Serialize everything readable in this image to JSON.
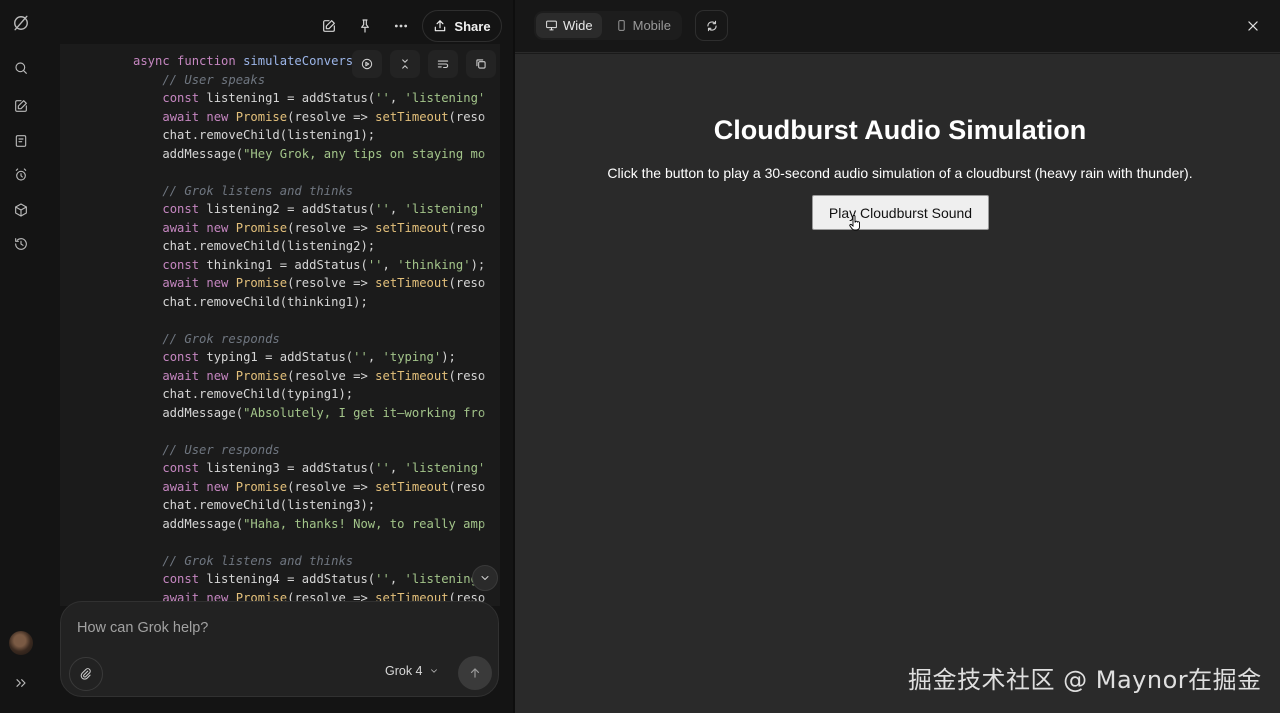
{
  "topbar": {
    "share_label": "Share"
  },
  "code": {
    "lines": [
      [
        {
          "t": "async function ",
          "c": "kw"
        },
        {
          "t": "simulateConvers",
          "c": "fn"
        }
      ],
      [
        {
          "t": "    // User speaks",
          "c": "cm"
        }
      ],
      [
        {
          "t": "    "
        },
        {
          "t": "const",
          "c": "kw"
        },
        {
          "t": " listening1 = addStatus("
        },
        {
          "t": "''",
          "c": "st"
        },
        {
          "t": ", "
        },
        {
          "t": "'listening'",
          "c": "st"
        }
      ],
      [
        {
          "t": "    "
        },
        {
          "t": "await new ",
          "c": "kw"
        },
        {
          "t": "Promise",
          "c": "cl"
        },
        {
          "t": "(resolve => "
        },
        {
          "t": "setTimeout",
          "c": "cl"
        },
        {
          "t": "(reso"
        }
      ],
      [
        {
          "t": "    chat.removeChild(listening1);"
        }
      ],
      [
        {
          "t": "    addMessage("
        },
        {
          "t": "\"Hey Grok, any tips on staying mo",
          "c": "st"
        }
      ],
      [
        {
          "t": ""
        }
      ],
      [
        {
          "t": "    // Grok listens and thinks",
          "c": "cm"
        }
      ],
      [
        {
          "t": "    "
        },
        {
          "t": "const",
          "c": "kw"
        },
        {
          "t": " listening2 = addStatus("
        },
        {
          "t": "''",
          "c": "st"
        },
        {
          "t": ", "
        },
        {
          "t": "'listening'",
          "c": "st"
        }
      ],
      [
        {
          "t": "    "
        },
        {
          "t": "await new ",
          "c": "kw"
        },
        {
          "t": "Promise",
          "c": "cl"
        },
        {
          "t": "(resolve => "
        },
        {
          "t": "setTimeout",
          "c": "cl"
        },
        {
          "t": "(reso"
        }
      ],
      [
        {
          "t": "    chat.removeChild(listening2);"
        }
      ],
      [
        {
          "t": "    "
        },
        {
          "t": "const",
          "c": "kw"
        },
        {
          "t": " thinking1 = addStatus("
        },
        {
          "t": "''",
          "c": "st"
        },
        {
          "t": ", "
        },
        {
          "t": "'thinking'",
          "c": "st"
        },
        {
          "t": ");"
        }
      ],
      [
        {
          "t": "    "
        },
        {
          "t": "await new ",
          "c": "kw"
        },
        {
          "t": "Promise",
          "c": "cl"
        },
        {
          "t": "(resolve => "
        },
        {
          "t": "setTimeout",
          "c": "cl"
        },
        {
          "t": "(reso"
        }
      ],
      [
        {
          "t": "    chat.removeChild(thinking1);"
        }
      ],
      [
        {
          "t": ""
        }
      ],
      [
        {
          "t": "    // Grok responds",
          "c": "cm"
        }
      ],
      [
        {
          "t": "    "
        },
        {
          "t": "const",
          "c": "kw"
        },
        {
          "t": " typing1 = addStatus("
        },
        {
          "t": "''",
          "c": "st"
        },
        {
          "t": ", "
        },
        {
          "t": "'typing'",
          "c": "st"
        },
        {
          "t": ");"
        }
      ],
      [
        {
          "t": "    "
        },
        {
          "t": "await new ",
          "c": "kw"
        },
        {
          "t": "Promise",
          "c": "cl"
        },
        {
          "t": "(resolve => "
        },
        {
          "t": "setTimeout",
          "c": "cl"
        },
        {
          "t": "(reso"
        }
      ],
      [
        {
          "t": "    chat.removeChild(typing1);"
        }
      ],
      [
        {
          "t": "    addMessage("
        },
        {
          "t": "\"Absolutely, I get it—working fro",
          "c": "st"
        }
      ],
      [
        {
          "t": ""
        }
      ],
      [
        {
          "t": "    // User responds",
          "c": "cm"
        }
      ],
      [
        {
          "t": "    "
        },
        {
          "t": "const",
          "c": "kw"
        },
        {
          "t": " listening3 = addStatus("
        },
        {
          "t": "''",
          "c": "st"
        },
        {
          "t": ", "
        },
        {
          "t": "'listening'",
          "c": "st"
        }
      ],
      [
        {
          "t": "    "
        },
        {
          "t": "await new ",
          "c": "kw"
        },
        {
          "t": "Promise",
          "c": "cl"
        },
        {
          "t": "(resolve => "
        },
        {
          "t": "setTimeout",
          "c": "cl"
        },
        {
          "t": "(reso"
        }
      ],
      [
        {
          "t": "    chat.removeChild(listening3);"
        }
      ],
      [
        {
          "t": "    addMessage("
        },
        {
          "t": "\"Haha, thanks! Now, to really amp",
          "c": "st"
        }
      ],
      [
        {
          "t": ""
        }
      ],
      [
        {
          "t": "    // Grok listens and thinks",
          "c": "cm"
        }
      ],
      [
        {
          "t": "    "
        },
        {
          "t": "const",
          "c": "kw"
        },
        {
          "t": " listening4 = addStatus("
        },
        {
          "t": "''",
          "c": "st"
        },
        {
          "t": ", "
        },
        {
          "t": "'listening",
          "c": "st"
        }
      ],
      [
        {
          "t": "    "
        },
        {
          "t": "await new ",
          "c": "kw"
        },
        {
          "t": "Promise",
          "c": "cl"
        },
        {
          "t": "(resolve => "
        },
        {
          "t": "setTimeout",
          "c": "cl"
        },
        {
          "t": "(reso"
        }
      ]
    ]
  },
  "prompt": {
    "placeholder": "How can Grok help?",
    "model": "Grok 4"
  },
  "preview": {
    "tabs": [
      {
        "label": "Wide"
      },
      {
        "label": "Mobile"
      }
    ],
    "title": "Cloudburst Audio Simulation",
    "description": "Click the button to play a 30-second audio simulation of a cloudburst (heavy rain with thunder).",
    "button_label": "Play Cloudburst Sound"
  },
  "watermark": "掘金技术社区 @ Maynor在掘金"
}
